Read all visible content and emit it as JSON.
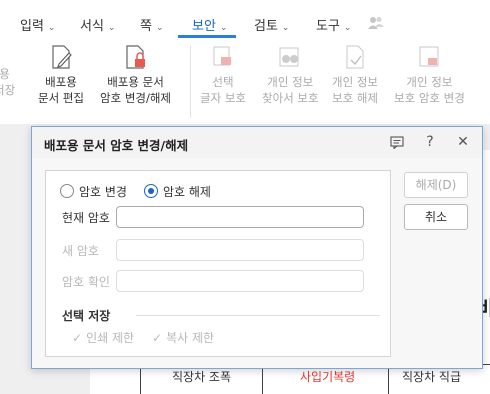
{
  "menu": {
    "tabs": [
      {
        "label": "입력"
      },
      {
        "label": "서식"
      },
      {
        "label": "쪽"
      },
      {
        "label": "보안"
      },
      {
        "label": "검토"
      },
      {
        "label": "도구"
      }
    ],
    "chevron": "⌄"
  },
  "ribbon": {
    "left_cut": {
      "line1": "용",
      "line2": "저장"
    },
    "buttons": [
      {
        "line1": "배포용",
        "line2": "문서 편집"
      },
      {
        "line1": "배포용 문서",
        "line2": "암호 변경/해제"
      },
      {
        "line1": "선택",
        "line2": "글자 보호"
      },
      {
        "line1": "개인 정보",
        "line2": "찾아서 보호"
      },
      {
        "line1": "개인 정보",
        "line2": "보호 해제"
      },
      {
        "line1": "개인 정보",
        "line2": "보호 암호 변경"
      }
    ]
  },
  "document": {
    "heading_fragment": "비",
    "table_cells": [
      "직장차 조폭",
      "사입기복령",
      "직장차 직급"
    ]
  },
  "dialog": {
    "title": "배포용 문서 암호 변경/해제",
    "radio_change": "암호 변경",
    "radio_release": "암호 해제",
    "selected_radio": "release",
    "current_pw_label": "현재 암호",
    "current_pw_value": "",
    "new_pw_label": "새 암호",
    "confirm_pw_label": "암호 확인",
    "group_title": "선택 저장",
    "check_print": "인쇄 제한",
    "check_copy": "복사 제한",
    "release_button": "해제(D)",
    "cancel_button": "취소"
  },
  "colors": {
    "accent": "#2a7de1",
    "dialog_border": "#7aa6da",
    "red_doc_text": "#e53935"
  }
}
